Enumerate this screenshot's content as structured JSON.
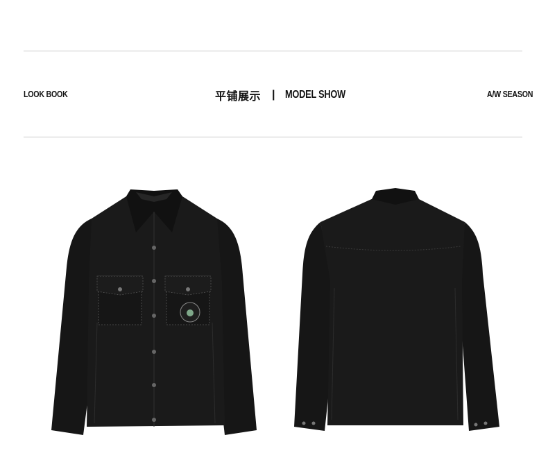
{
  "header": {
    "left_label": "LOOK BOOK",
    "center_cn": "平铺展示",
    "center_separator": "|",
    "center_en": "MODEL SHOW",
    "right_label": "A/W SEASON"
  },
  "colors": {
    "garment": "#1a1a1a",
    "garment_shade": "#0d0d0d",
    "stitch": "#5a5a5a",
    "rule": "#c9c9c9",
    "badge_accent": "#7fa88a"
  },
  "images": {
    "front": "jacket-front-icon",
    "back": "jacket-back-icon"
  }
}
